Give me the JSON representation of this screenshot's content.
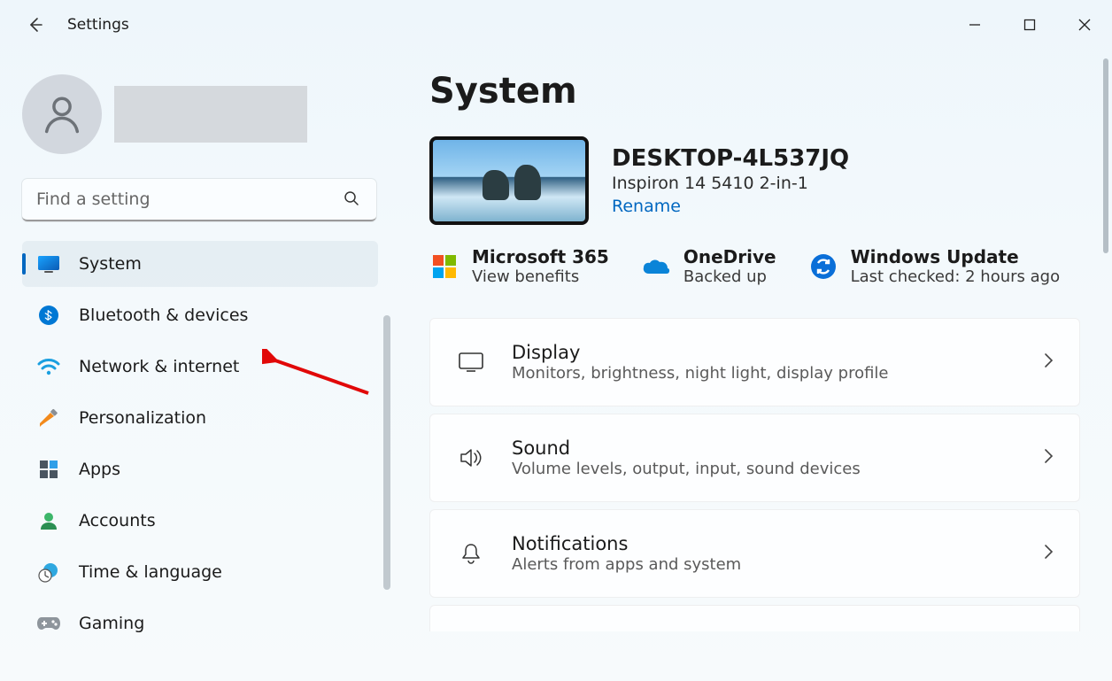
{
  "window": {
    "title": "Settings"
  },
  "search": {
    "placeholder": "Find a setting"
  },
  "sidebar": {
    "items": [
      {
        "key": "system",
        "label": "System",
        "selected": true,
        "icon": "monitor-icon"
      },
      {
        "key": "bluetooth",
        "label": "Bluetooth & devices",
        "selected": false,
        "icon": "bluetooth-icon"
      },
      {
        "key": "network",
        "label": "Network & internet",
        "selected": false,
        "icon": "wifi-icon"
      },
      {
        "key": "personalization",
        "label": "Personalization",
        "selected": false,
        "icon": "paintbrush-icon"
      },
      {
        "key": "apps",
        "label": "Apps",
        "selected": false,
        "icon": "apps-icon"
      },
      {
        "key": "accounts",
        "label": "Accounts",
        "selected": false,
        "icon": "person-icon"
      },
      {
        "key": "time",
        "label": "Time & language",
        "selected": false,
        "icon": "clock-globe-icon"
      },
      {
        "key": "gaming",
        "label": "Gaming",
        "selected": false,
        "icon": "gamepad-icon"
      }
    ]
  },
  "page": {
    "title": "System"
  },
  "device": {
    "name": "DESKTOP-4L537JQ",
    "model": "Inspiron 14 5410 2-in-1",
    "rename": "Rename"
  },
  "status": {
    "m365": {
      "title": "Microsoft 365",
      "sub": "View benefits"
    },
    "onedrive": {
      "title": "OneDrive",
      "sub": "Backed up"
    },
    "update": {
      "title": "Windows Update",
      "sub": "Last checked: 2 hours ago"
    }
  },
  "cards": [
    {
      "title": "Display",
      "sub": "Monitors, brightness, night light, display profile",
      "icon": "display-icon"
    },
    {
      "title": "Sound",
      "sub": "Volume levels, output, input, sound devices",
      "icon": "sound-icon"
    },
    {
      "title": "Notifications",
      "sub": "Alerts from apps and system",
      "icon": "bell-icon"
    }
  ],
  "colors": {
    "accent": "#0067c0",
    "annotation_arrow": "#e10808"
  }
}
